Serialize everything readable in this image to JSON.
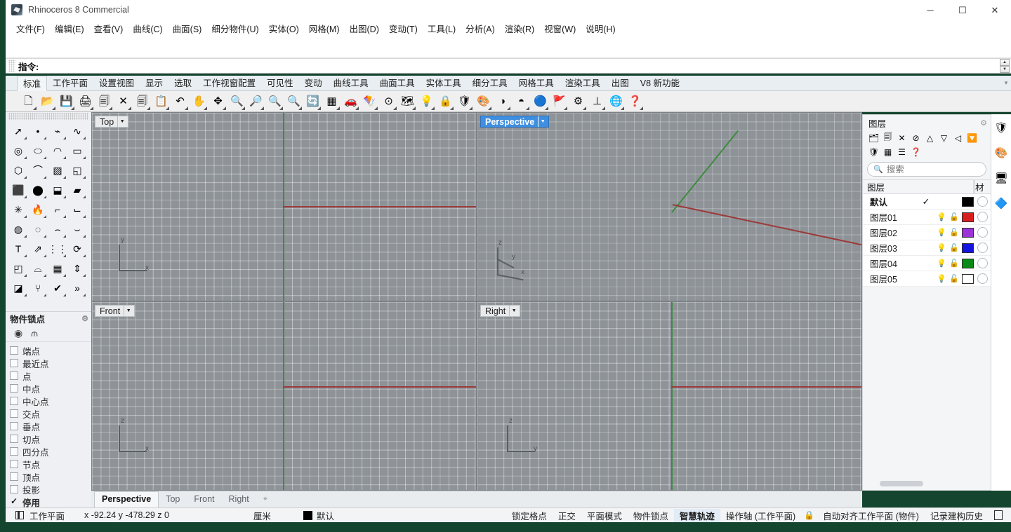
{
  "window": {
    "title": "Rhinoceros 8 Commercial",
    "app_icon": "rhino-logo-icon",
    "minimize": "─",
    "maximize": "☐",
    "close": "✕"
  },
  "menubar": {
    "items": [
      {
        "label": "文件(F)",
        "name": "menu-file"
      },
      {
        "label": "编辑(E)",
        "name": "menu-edit"
      },
      {
        "label": "查看(V)",
        "name": "menu-view"
      },
      {
        "label": "曲线(C)",
        "name": "menu-curve"
      },
      {
        "label": "曲面(S)",
        "name": "menu-surface"
      },
      {
        "label": "细分物件(U)",
        "name": "menu-subd"
      },
      {
        "label": "实体(O)",
        "name": "menu-solid"
      },
      {
        "label": "网格(M)",
        "name": "menu-mesh"
      },
      {
        "label": "出图(D)",
        "name": "menu-drafting"
      },
      {
        "label": "变动(T)",
        "name": "menu-transform"
      },
      {
        "label": "工具(L)",
        "name": "menu-tools"
      },
      {
        "label": "分析(A)",
        "name": "menu-analyze"
      },
      {
        "label": "渲染(R)",
        "name": "menu-render"
      },
      {
        "label": "视窗(W)",
        "name": "menu-window"
      },
      {
        "label": "说明(H)",
        "name": "menu-help"
      }
    ]
  },
  "command": {
    "label": "指令:",
    "value": "",
    "placeholder": ""
  },
  "toolbar_tabs": {
    "active": "标准",
    "items": [
      "标准",
      "工作平面",
      "设置视图",
      "显示",
      "选取",
      "工作视窗配置",
      "可见性",
      "变动",
      "曲线工具",
      "曲面工具",
      "实体工具",
      "细分工具",
      "网格工具",
      "渲染工具",
      "出图",
      "V8 新功能"
    ]
  },
  "main_toolbar": {
    "icons": [
      {
        "name": "new-file-icon",
        "glyph": "🗋"
      },
      {
        "name": "open-file-icon",
        "glyph": "📂"
      },
      {
        "name": "save-file-icon",
        "glyph": "💾"
      },
      {
        "name": "print-icon",
        "glyph": "🖨"
      },
      {
        "name": "cut-icon",
        "glyph": "🗐"
      },
      {
        "name": "delete-icon",
        "glyph": "✕"
      },
      {
        "name": "copy-icon",
        "glyph": "🗐"
      },
      {
        "name": "paste-icon",
        "glyph": "📋"
      },
      {
        "name": "undo-icon",
        "glyph": "↶"
      },
      {
        "name": "pan-icon",
        "glyph": "✋"
      },
      {
        "name": "move-view-icon",
        "glyph": "✥"
      },
      {
        "name": "zoom-in-icon",
        "glyph": "🔍"
      },
      {
        "name": "zoom-window-icon",
        "glyph": "🔎"
      },
      {
        "name": "zoom-extents-icon",
        "glyph": "🔍"
      },
      {
        "name": "zoom-selected-icon",
        "glyph": "🔍"
      },
      {
        "name": "zoom-previous-icon",
        "glyph": "🔄"
      },
      {
        "name": "grid-icon",
        "glyph": "▦"
      },
      {
        "name": "car-render-icon",
        "glyph": "🚗"
      },
      {
        "name": "wireframe-icon",
        "glyph": "🪁"
      },
      {
        "name": "analyze-direction-icon",
        "glyph": "⊙"
      },
      {
        "name": "layout-icon",
        "glyph": "🗺"
      },
      {
        "name": "light-icon",
        "glyph": "💡"
      },
      {
        "name": "lock-icon",
        "glyph": "🔒"
      },
      {
        "name": "shield-icon",
        "glyph": "🛡"
      },
      {
        "name": "color-wheel-icon",
        "glyph": "🎨"
      },
      {
        "name": "shade-icon",
        "glyph": "◑"
      },
      {
        "name": "ghosted-icon",
        "glyph": "◓"
      },
      {
        "name": "render-sphere-icon",
        "glyph": "🔵"
      },
      {
        "name": "flag-icon",
        "glyph": "🚩"
      },
      {
        "name": "gear-render-icon",
        "glyph": "⚙"
      },
      {
        "name": "dimension-icon",
        "glyph": "⊥"
      },
      {
        "name": "earth-icon",
        "glyph": "🌐"
      },
      {
        "name": "help-icon",
        "glyph": "❓"
      }
    ]
  },
  "left_toolbar": {
    "icons": [
      {
        "name": "select-arrow-icon",
        "glyph": "➚"
      },
      {
        "name": "point-icon",
        "glyph": "•"
      },
      {
        "name": "polyline-icon",
        "glyph": "⌁"
      },
      {
        "name": "curve-icon",
        "glyph": "∿"
      },
      {
        "name": "circle-icon",
        "glyph": "◎"
      },
      {
        "name": "ellipse-icon",
        "glyph": "⬭"
      },
      {
        "name": "arc-icon",
        "glyph": "◠"
      },
      {
        "name": "rectangle-icon",
        "glyph": "▭"
      },
      {
        "name": "polygon-icon",
        "glyph": "⬡"
      },
      {
        "name": "freeform-curve-icon",
        "glyph": "⌒"
      },
      {
        "name": "surface-from-curves-icon",
        "glyph": "▨"
      },
      {
        "name": "surface-sweep-icon",
        "glyph": "◱"
      },
      {
        "name": "box-icon",
        "glyph": "⬛"
      },
      {
        "name": "sphere-icon",
        "glyph": "⬤"
      },
      {
        "name": "cylinder-icon",
        "glyph": "⬓"
      },
      {
        "name": "subd-box-icon",
        "glyph": "▰"
      },
      {
        "name": "explode-icon",
        "glyph": "✳"
      },
      {
        "name": "boolean-icon",
        "glyph": "🔥"
      },
      {
        "name": "fillet-icon",
        "glyph": "⌐"
      },
      {
        "name": "chamfer-icon",
        "glyph": "⌙"
      },
      {
        "name": "boolean-union-icon",
        "glyph": "◍"
      },
      {
        "name": "boolean-diff-icon",
        "glyph": "◌"
      },
      {
        "name": "offset-curve-icon",
        "glyph": "⌢"
      },
      {
        "name": "extend-curve-icon",
        "glyph": "⌣"
      },
      {
        "name": "text-icon",
        "glyph": "T"
      },
      {
        "name": "transform-icon",
        "glyph": "⇗"
      },
      {
        "name": "array-icon",
        "glyph": "⋮⋮"
      },
      {
        "name": "rotate-icon",
        "glyph": "⟳"
      },
      {
        "name": "solid-tools-icon",
        "glyph": "◰"
      },
      {
        "name": "loft-icon",
        "glyph": "⌓"
      },
      {
        "name": "grid-array-icon",
        "glyph": "▦"
      },
      {
        "name": "scale-icon",
        "glyph": "⇕"
      },
      {
        "name": "split-icon",
        "glyph": "◪"
      },
      {
        "name": "analysis-icon",
        "glyph": "⑂"
      },
      {
        "name": "check-icon",
        "glyph": "✔"
      },
      {
        "name": "more-icon",
        "glyph": "»"
      }
    ]
  },
  "osnap": {
    "title": "物件锁点",
    "gear": "⚙",
    "tools": [
      {
        "name": "osnap-toggle-icon",
        "glyph": "◉"
      },
      {
        "name": "osnap-filter-icon",
        "glyph": "⫙"
      }
    ],
    "items": [
      {
        "label": "端点",
        "checked": false
      },
      {
        "label": "最近点",
        "checked": false
      },
      {
        "label": "点",
        "checked": false
      },
      {
        "label": "中点",
        "checked": false
      },
      {
        "label": "中心点",
        "checked": false
      },
      {
        "label": "交点",
        "checked": false
      },
      {
        "label": "垂点",
        "checked": false
      },
      {
        "label": "切点",
        "checked": false
      },
      {
        "label": "四分点",
        "checked": false
      },
      {
        "label": "节点",
        "checked": false
      },
      {
        "label": "顶点",
        "checked": false
      },
      {
        "label": "投影",
        "checked": false
      },
      {
        "label": "停用",
        "checked": true
      }
    ]
  },
  "viewports": [
    {
      "name": "viewport-top",
      "label": "Top",
      "active": false,
      "axes": [
        "y",
        "x"
      ]
    },
    {
      "name": "viewport-perspective",
      "label": "Perspective",
      "active": true,
      "axes": [
        "z",
        "y",
        "x"
      ]
    },
    {
      "name": "viewport-front",
      "label": "Front",
      "active": false,
      "axes": [
        "z",
        "x"
      ]
    },
    {
      "name": "viewport-right",
      "label": "Right",
      "active": false,
      "axes": [
        "z",
        "y"
      ]
    }
  ],
  "viewport_tabs": {
    "active": "Perspective",
    "items": [
      "Perspective",
      "Top",
      "Front",
      "Right"
    ],
    "add": "⌖"
  },
  "layers_panel": {
    "title": "图层",
    "gear": "⚙",
    "tools": [
      {
        "name": "new-layer-icon",
        "glyph": "🗂"
      },
      {
        "name": "duplicate-layer-icon",
        "glyph": "🗐"
      },
      {
        "name": "delete-layer-icon",
        "glyph": "✕"
      },
      {
        "name": "layer-filter-icon",
        "glyph": "⊘"
      },
      {
        "name": "move-up-icon",
        "glyph": "△"
      },
      {
        "name": "move-down-icon",
        "glyph": "▽"
      },
      {
        "name": "move-back-icon",
        "glyph": "◁"
      },
      {
        "name": "filter-funnel-icon",
        "glyph": "🔽"
      },
      {
        "name": "layer-colors-icon",
        "glyph": "🛡"
      },
      {
        "name": "grid-view-icon",
        "glyph": "▦"
      },
      {
        "name": "list-view-icon",
        "glyph": "☰"
      },
      {
        "name": "help-icon",
        "glyph": "❓"
      }
    ],
    "search": {
      "placeholder": "搜索",
      "value": "",
      "icon": "search-icon"
    },
    "columns": {
      "name": "图层",
      "material": "材"
    },
    "rows": [
      {
        "name": "默认",
        "current": true,
        "check": "✓",
        "bulb": "",
        "lock": "",
        "color": "#000000"
      },
      {
        "name": "图层01",
        "current": false,
        "check": "",
        "bulb": "💡",
        "lock": "🔓",
        "color": "#d81f1f"
      },
      {
        "name": "图层02",
        "current": false,
        "check": "",
        "bulb": "💡",
        "lock": "🔓",
        "color": "#9c33d8"
      },
      {
        "name": "图层03",
        "current": false,
        "check": "",
        "bulb": "💡",
        "lock": "🔓",
        "color": "#1414e0"
      },
      {
        "name": "图层04",
        "current": false,
        "check": "",
        "bulb": "💡",
        "lock": "🔓",
        "color": "#0a8a16"
      },
      {
        "name": "图层05",
        "current": false,
        "check": "",
        "bulb": "💡",
        "lock": "🔓",
        "color": "#ffffff"
      }
    ]
  },
  "dock_tabs": [
    {
      "name": "layers-tab-icon",
      "glyph": "🛡"
    },
    {
      "name": "color-wheel-tab-icon",
      "glyph": "🎨"
    },
    {
      "name": "display-tab-icon",
      "glyph": "🖥"
    },
    {
      "name": "properties-tab-icon",
      "glyph": "🔷"
    }
  ],
  "statusbar": {
    "cplane_label": "工作平面",
    "coordinates": "x -92.24  y -478.29  z 0",
    "units": "厘米",
    "layer_color": "#000000",
    "layer_name": "默认",
    "toggles": [
      {
        "label": "锁定格点",
        "active": false
      },
      {
        "label": "正交",
        "active": false
      },
      {
        "label": "平面模式",
        "active": false
      },
      {
        "label": "物件锁点",
        "active": false
      },
      {
        "label": "智慧轨迹",
        "active": true
      },
      {
        "label": "操作轴 (工作平面)",
        "active": false
      }
    ],
    "lock_icon": "🔒",
    "toggles2": [
      {
        "label": "自动对齐工作平面 (物件)",
        "active": false
      },
      {
        "label": "记录建构历史",
        "active": false
      }
    ]
  }
}
